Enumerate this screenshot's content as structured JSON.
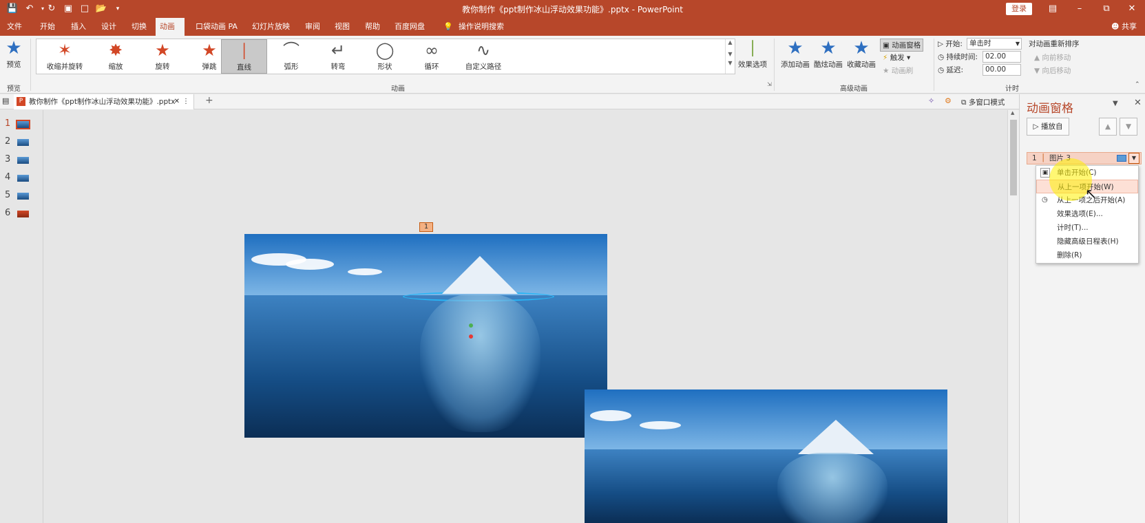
{
  "titlebar": {
    "document_title": "教你制作《ppt制作冰山浮动效果功能》.pptx - PowerPoint",
    "login_label": "登录",
    "quick_access_icons": [
      "save-icon",
      "undo-icon",
      "redo-icon",
      "present-icon",
      "new-icon",
      "open-icon",
      "customize-icon"
    ]
  },
  "menubar": {
    "tabs": [
      "文件",
      "开始",
      "插入",
      "设计",
      "切换",
      "动画",
      "口袋动画 PA",
      "幻灯片放映",
      "审阅",
      "视图",
      "帮助",
      "百度网盘",
      "操作说明搜索"
    ],
    "active_tab": "动画",
    "share_label": "共享"
  },
  "ribbon": {
    "preview_label": "预览",
    "preview_group": "预览",
    "gallery_items": [
      "收缩并旋转",
      "缩放",
      "旋转",
      "弹跳",
      "直线",
      "弧形",
      "转弯",
      "形状",
      "循环",
      "自定义路径"
    ],
    "selected_gallery_item": "直线",
    "animation_group": "动画",
    "effect_options_label": "效果选项",
    "advanced": {
      "add_animation": "添加动画",
      "painter_animation": "酷炫动画",
      "collect_animation": "收藏动画",
      "animation_pane": "动画窗格",
      "trigger": "触发",
      "animation_brush": "动画刷",
      "group_label": "高级动画"
    },
    "timing": {
      "start_label": "开始:",
      "start_value": "单击时",
      "duration_label": "持续时间:",
      "duration_value": "02.00",
      "delay_label": "延迟:",
      "delay_value": "00.00",
      "reorder_label": "对动画重新排序",
      "move_earlier": "向前移动",
      "move_later": "向后移动",
      "group_label": "计时"
    }
  },
  "tabstrip": {
    "doc_tab": "教你制作《ppt制作冰山浮动效果功能》.pptx",
    "multi_window": "多窗口模式"
  },
  "thumbnails": [
    "1",
    "2",
    "3",
    "4",
    "5",
    "6"
  ],
  "selected_thumbnail": "1",
  "slide": {
    "animation_badge": "1"
  },
  "pane": {
    "title": "动画窗格",
    "play_from": "播放自",
    "item_number": "1",
    "item_label": "图片 3",
    "context_menu": [
      "单击开始(C)",
      "从上一项开始(W)",
      "从上一项之后开始(A)",
      "效果选项(E)...",
      "计时(T)...",
      "隐藏高级日程表(H)",
      "删除(R)"
    ],
    "highlighted_menu_item": "从上一项开始(W)"
  },
  "colors": {
    "accent": "#b7472a",
    "highlight": "#fde0d6"
  }
}
